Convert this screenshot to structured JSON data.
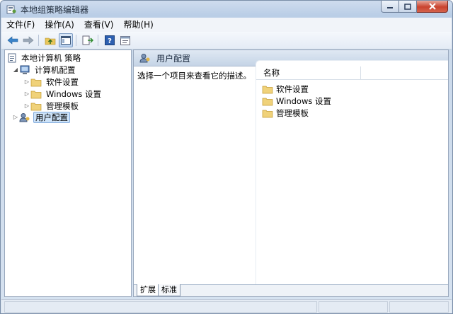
{
  "window": {
    "title": "本地组策略编辑器",
    "icons": {
      "app": "policy-editor-icon",
      "minimize": "minimize-icon",
      "maximize": "maximize-icon",
      "close": "close-icon"
    },
    "accent": "#cde3f9"
  },
  "menubar": {
    "items": [
      "文件(F)",
      "操作(A)",
      "查看(V)",
      "帮助(H)"
    ]
  },
  "toolbar": {
    "buttons": [
      "back-arrow-icon",
      "forward-arrow-icon",
      "up-folder-icon",
      "show-hide-tree-icon",
      "export-list-icon",
      "help-icon",
      "properties-icon"
    ]
  },
  "tree": {
    "root": "本地计算机 策略",
    "computer_config": "计算机配置",
    "children": [
      "软件设置",
      "Windows 设置",
      "管理模板"
    ],
    "user_config": "用户配置"
  },
  "right": {
    "header": "用户配置",
    "description": "选择一个项目来查看它的描述。",
    "column_name": "名称",
    "items": [
      "软件设置",
      "Windows 设置",
      "管理模板"
    ],
    "tabs": [
      "扩展",
      "标准"
    ]
  }
}
